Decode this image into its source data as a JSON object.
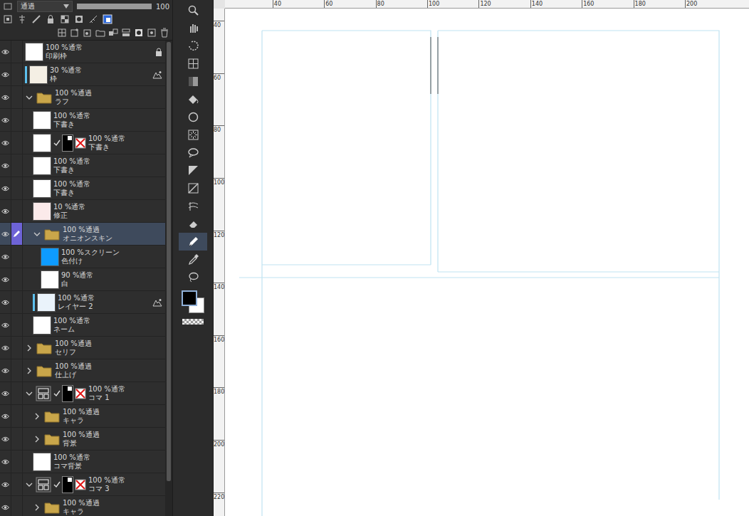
{
  "layer_panel": {
    "blend_mode": "通過",
    "opacity": "100",
    "opacity_level": 1.0,
    "scroll_level": 0.93
  },
  "layers": [
    {
      "mode": "100 %通常",
      "name": "印刷枠",
      "kind": "layer",
      "depth": 0,
      "visible": true,
      "selected": false,
      "expanded": false,
      "locked": true,
      "reference": false,
      "mask": false,
      "color": "#ffffff"
    },
    {
      "mode": "30 %通常",
      "name": "枠",
      "kind": "layer",
      "depth": 0,
      "visible": true,
      "selected": false,
      "expanded": false,
      "locked": false,
      "reference": true,
      "mask": false,
      "color": "#f4efe4"
    },
    {
      "mode": "100 %通過",
      "name": "ラフ",
      "kind": "folder",
      "depth": 0,
      "visible": true,
      "selected": false,
      "expanded": true,
      "locked": false,
      "reference": false,
      "mask": false,
      "color": "#c9a64a"
    },
    {
      "mode": "100 %通常",
      "name": "下書き",
      "kind": "layer",
      "depth": 1,
      "visible": true,
      "selected": false,
      "expanded": false,
      "locked": false,
      "reference": false,
      "mask": false,
      "color": "#ffffff"
    },
    {
      "mode": "100 %通常",
      "name": "下書き",
      "kind": "layer",
      "depth": 1,
      "visible": true,
      "selected": false,
      "expanded": false,
      "locked": false,
      "reference": false,
      "mask": true,
      "color": "#ffffff"
    },
    {
      "mode": "100 %通常",
      "name": "下書き",
      "kind": "layer",
      "depth": 1,
      "visible": true,
      "selected": false,
      "expanded": false,
      "locked": false,
      "reference": false,
      "mask": false,
      "color": "#ffffff"
    },
    {
      "mode": "100 %通常",
      "name": "下書き",
      "kind": "layer",
      "depth": 1,
      "visible": true,
      "selected": false,
      "expanded": false,
      "locked": false,
      "reference": false,
      "mask": false,
      "color": "#ffffff"
    },
    {
      "mode": "10 %通常",
      "name": "修正",
      "kind": "layer",
      "depth": 1,
      "visible": true,
      "selected": false,
      "expanded": false,
      "locked": false,
      "reference": false,
      "mask": false,
      "color": "#fbeaea"
    },
    {
      "mode": "100 %通過",
      "name": "オニオンスキン",
      "kind": "folder",
      "depth": 1,
      "visible": true,
      "selected": true,
      "expanded": true,
      "locked": false,
      "reference": false,
      "mask": false,
      "color": "#c9a64a"
    },
    {
      "mode": "100 %スクリーン",
      "name": "色付け",
      "kind": "layer",
      "depth": 2,
      "visible": true,
      "selected": false,
      "expanded": false,
      "locked": false,
      "reference": false,
      "mask": false,
      "color": "#0e9bff"
    },
    {
      "mode": "90 %通常",
      "name": "白",
      "kind": "layer",
      "depth": 2,
      "visible": true,
      "selected": false,
      "expanded": false,
      "locked": false,
      "reference": false,
      "mask": false,
      "color": "#ffffff"
    },
    {
      "mode": "100 %通常",
      "name": "レイヤー 2",
      "kind": "layer",
      "depth": 1,
      "visible": true,
      "selected": false,
      "expanded": false,
      "locked": false,
      "reference": true,
      "mask": false,
      "color": "#eaf3fb"
    },
    {
      "mode": "100 %通常",
      "name": "ネーム",
      "kind": "layer",
      "depth": 1,
      "visible": true,
      "selected": false,
      "expanded": false,
      "locked": false,
      "reference": false,
      "mask": false,
      "color": "#ffffff"
    },
    {
      "mode": "100 %通過",
      "name": "セリフ",
      "kind": "folder",
      "depth": 0,
      "visible": true,
      "selected": false,
      "expanded": false,
      "locked": false,
      "reference": false,
      "mask": false,
      "color": "#c9a64a"
    },
    {
      "mode": "100 %通過",
      "name": "仕上げ",
      "kind": "folder",
      "depth": 0,
      "visible": true,
      "selected": false,
      "expanded": false,
      "locked": false,
      "reference": false,
      "mask": false,
      "color": "#c9a64a"
    },
    {
      "mode": "100 %通常",
      "name": "コマ 1",
      "kind": "frame",
      "depth": 0,
      "visible": true,
      "selected": false,
      "expanded": true,
      "locked": false,
      "reference": false,
      "mask": true,
      "color": "#ffffff"
    },
    {
      "mode": "100 %通過",
      "name": "キャラ",
      "kind": "folder",
      "depth": 1,
      "visible": true,
      "selected": false,
      "expanded": false,
      "locked": false,
      "reference": false,
      "mask": false,
      "color": "#c9a64a"
    },
    {
      "mode": "100 %通過",
      "name": "背景",
      "kind": "folder",
      "depth": 1,
      "visible": true,
      "selected": false,
      "expanded": false,
      "locked": false,
      "reference": false,
      "mask": false,
      "color": "#c9a64a"
    },
    {
      "mode": "100 %通常",
      "name": "コマ背景",
      "kind": "layer",
      "depth": 1,
      "visible": true,
      "selected": false,
      "expanded": false,
      "locked": false,
      "reference": false,
      "mask": false,
      "color": "#ffffff"
    },
    {
      "mode": "100 %通常",
      "name": "コマ 3",
      "kind": "frame",
      "depth": 0,
      "visible": true,
      "selected": false,
      "expanded": true,
      "locked": false,
      "reference": false,
      "mask": true,
      "color": "#ffffff"
    },
    {
      "mode": "100 %通過",
      "name": "キャラ",
      "kind": "folder",
      "depth": 1,
      "visible": true,
      "selected": false,
      "expanded": false,
      "locked": false,
      "reference": false,
      "mask": false,
      "color": "#c9a64a"
    }
  ],
  "tools": [
    {
      "selected": false
    },
    {
      "selected": false
    },
    {
      "selected": false
    },
    {
      "selected": false
    },
    {
      "selected": false
    },
    {
      "selected": false
    },
    {
      "selected": false
    },
    {
      "selected": false
    },
    {
      "selected": false
    },
    {
      "selected": false
    },
    {
      "selected": false
    },
    {
      "selected": false
    },
    {
      "selected": false
    },
    {
      "selected": true
    },
    {
      "selected": false
    },
    {
      "selected": false
    }
  ],
  "colors": {
    "main": "#000000",
    "sub": "#ffffff"
  },
  "rulers": {
    "top": [
      "40",
      "60",
      "80",
      "100",
      "120",
      "140",
      "160",
      "180",
      "200"
    ],
    "left": [
      "40",
      "60",
      "80",
      "100",
      "120",
      "140",
      "160",
      "180",
      "200",
      "220"
    ]
  }
}
